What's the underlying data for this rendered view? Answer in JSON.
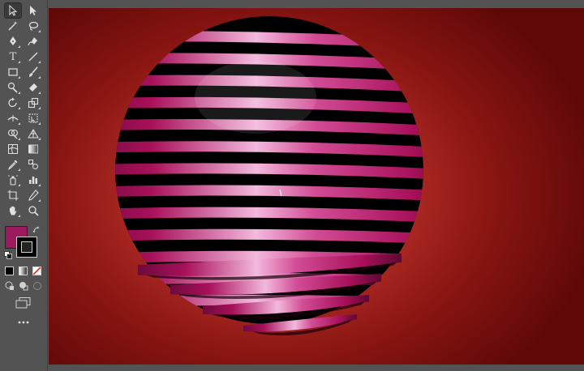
{
  "toolbar": {
    "tools": [
      {
        "name": "selection-tool",
        "icon": "arrow-icon",
        "active": true
      },
      {
        "name": "direct-selection-tool",
        "icon": "direct-arrow-icon"
      },
      {
        "name": "magic-wand-tool",
        "icon": "magic-wand-icon"
      },
      {
        "name": "lasso-tool",
        "icon": "lasso-icon"
      },
      {
        "name": "pen-tool",
        "icon": "pen-icon"
      },
      {
        "name": "curvature-tool",
        "icon": "curvature-pen-icon"
      },
      {
        "name": "type-tool",
        "icon": "type-icon",
        "glyph": "T"
      },
      {
        "name": "line-segment-tool",
        "icon": "line-icon"
      },
      {
        "name": "rectangle-tool",
        "icon": "rectangle-icon"
      },
      {
        "name": "paintbrush-tool",
        "icon": "paintbrush-icon"
      },
      {
        "name": "shaper-tool",
        "icon": "shaper-icon"
      },
      {
        "name": "eraser-tool",
        "icon": "eraser-icon"
      },
      {
        "name": "rotate-tool",
        "icon": "rotate-icon"
      },
      {
        "name": "scale-tool",
        "icon": "scale-icon"
      },
      {
        "name": "width-tool",
        "icon": "width-icon"
      },
      {
        "name": "free-transform-tool",
        "icon": "free-transform-icon"
      },
      {
        "name": "shape-builder-tool",
        "icon": "shape-builder-icon"
      },
      {
        "name": "perspective-grid-tool",
        "icon": "perspective-grid-icon"
      },
      {
        "name": "mesh-tool",
        "icon": "mesh-icon"
      },
      {
        "name": "gradient-tool",
        "icon": "gradient-icon"
      },
      {
        "name": "eyedropper-tool",
        "icon": "eyedropper-icon"
      },
      {
        "name": "blend-tool",
        "icon": "blend-icon"
      },
      {
        "name": "symbol-sprayer-tool",
        "icon": "symbol-sprayer-icon"
      },
      {
        "name": "column-graph-tool",
        "icon": "column-graph-icon"
      },
      {
        "name": "artboard-tool",
        "icon": "artboard-icon"
      },
      {
        "name": "slice-tool",
        "icon": "slice-icon"
      },
      {
        "name": "hand-tool",
        "icon": "hand-icon"
      },
      {
        "name": "zoom-tool",
        "icon": "zoom-icon"
      }
    ],
    "fill_color": "#9c1a5e",
    "stroke_color": "#000000"
  },
  "artwork": {
    "background_colors": [
      "#d2453a",
      "#5e0808"
    ],
    "stripe_color": "#b0125f",
    "stripe_highlight": "#f6c8e6",
    "gap_color": "#000000"
  }
}
